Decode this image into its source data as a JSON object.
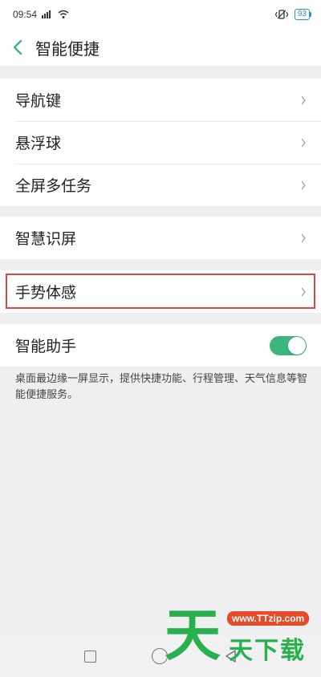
{
  "status_bar": {
    "time": "09:54",
    "battery": "93"
  },
  "header": {
    "title": "智能便捷"
  },
  "groups": [
    {
      "items": [
        {
          "label": "导航键"
        },
        {
          "label": "悬浮球"
        },
        {
          "label": "全屏多任务"
        }
      ]
    },
    {
      "items": [
        {
          "label": "智慧识屏"
        }
      ]
    },
    {
      "items": [
        {
          "label": "手势体感"
        }
      ]
    },
    {
      "items": [
        {
          "label": "智能助手",
          "toggle": "on"
        }
      ]
    }
  ],
  "description": "桌面最边缘一屏显示，提供快捷功能、行程管理、天气信息等智能便捷服务。",
  "watermark": {
    "big_char": "天",
    "url": "www.TTzip.com",
    "text": "天下载"
  },
  "colors": {
    "accent": "#3bb77e",
    "highlight": "#d84a3f",
    "battery": "#2f8ed6"
  }
}
